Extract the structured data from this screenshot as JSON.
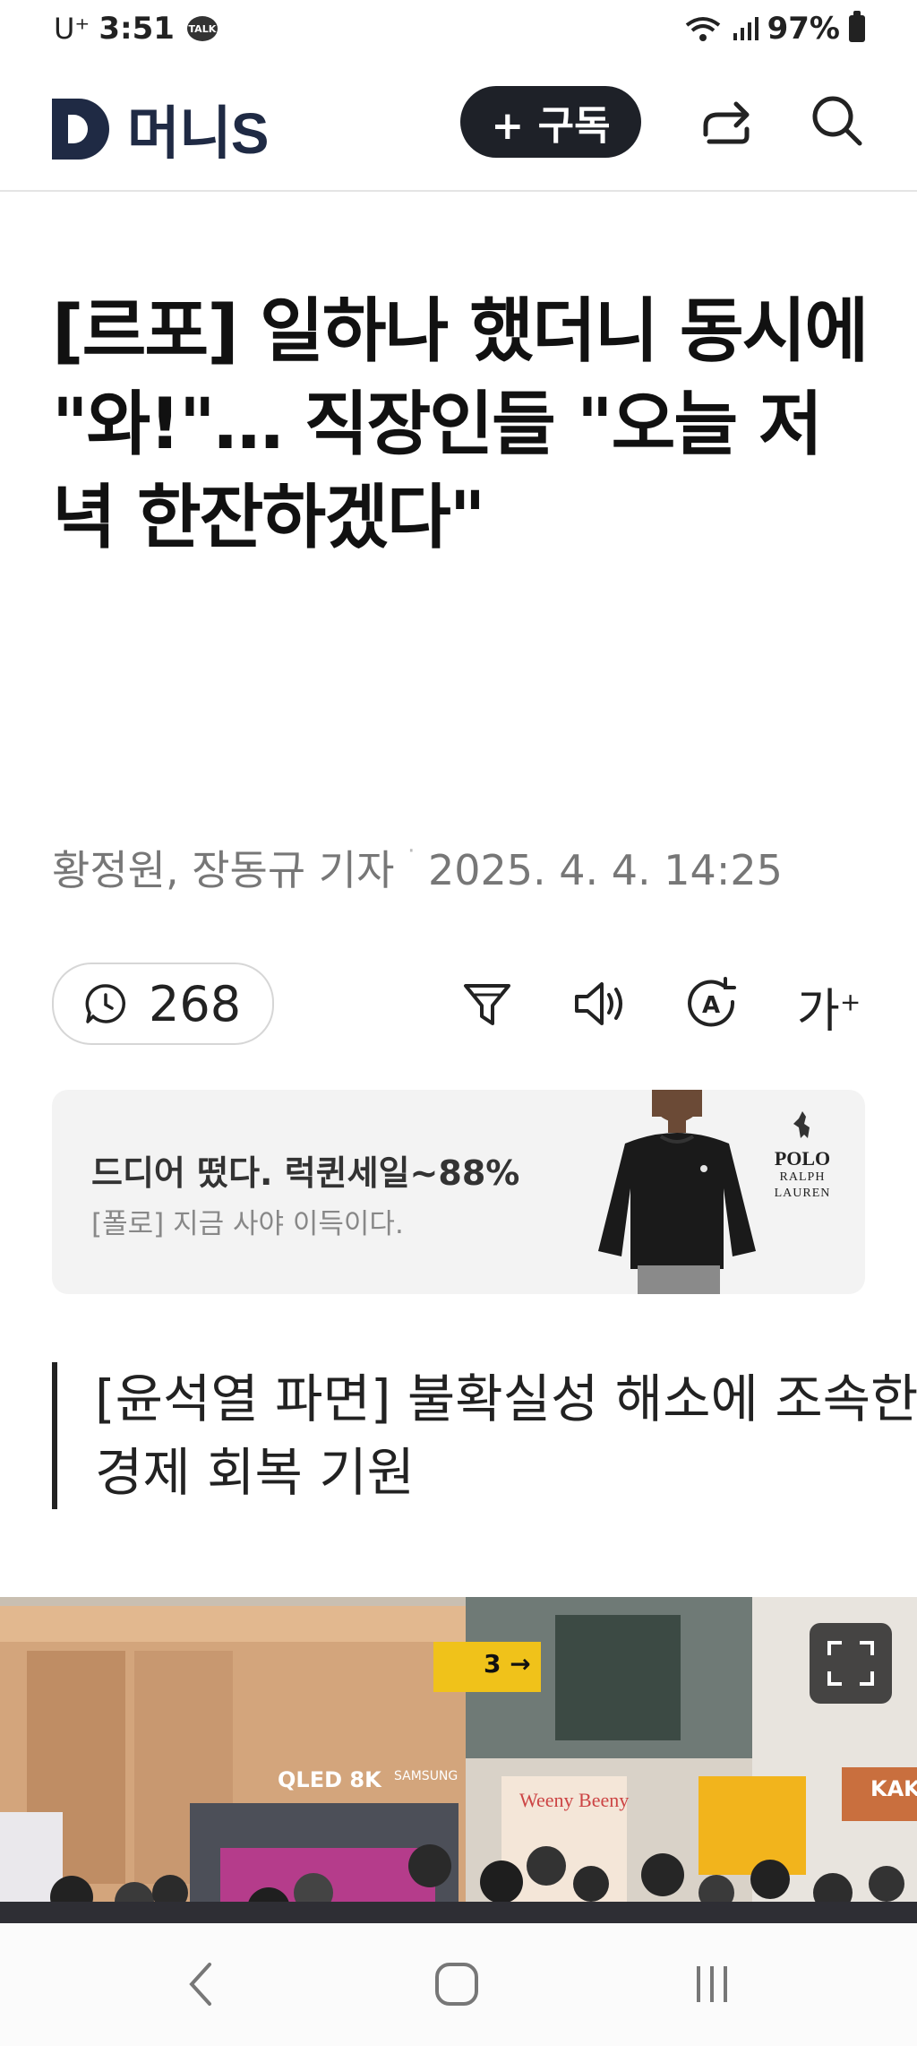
{
  "status_bar": {
    "carrier": "U⁺",
    "time": "3:51",
    "talk_badge": "TALK",
    "battery": "97%"
  },
  "header": {
    "logo_text": "머니S",
    "subscribe_label": "+ 구독"
  },
  "article": {
    "headline": "[르포] 일하나 했더니 동시에 \"와!\"… 직장인들 \"오늘 저녁 한잔하겠다\"",
    "byline": "황정원, 장동규 기자",
    "date": "2025. 4. 4. 14:25",
    "comment_count": "268",
    "font_size_label": "가",
    "subheadline": "[윤석열 파면] 불확실성 해소에 조속한 경제 회복 기원"
  },
  "ad": {
    "title": "드디어 떴다. 럭퀸세일~88%",
    "subtitle": "[폴로] 지금 사야 이득이다.",
    "brand_line1": "POLO",
    "brand_line2": "RALPH LAUREN"
  },
  "photo": {
    "sign_platform": "3 →",
    "sign_tv": "QLED 8K",
    "sign_brand": "SAMSUNG",
    "sign_store1": "Weeny Beeny",
    "sign_store2": "KAKA"
  },
  "icons": [
    "share-icon",
    "search-icon",
    "comment-icon",
    "filter-icon",
    "speaker-icon",
    "translate-icon",
    "font-size-icon",
    "expand-icon",
    "back-icon",
    "home-icon",
    "recents-icon"
  ]
}
